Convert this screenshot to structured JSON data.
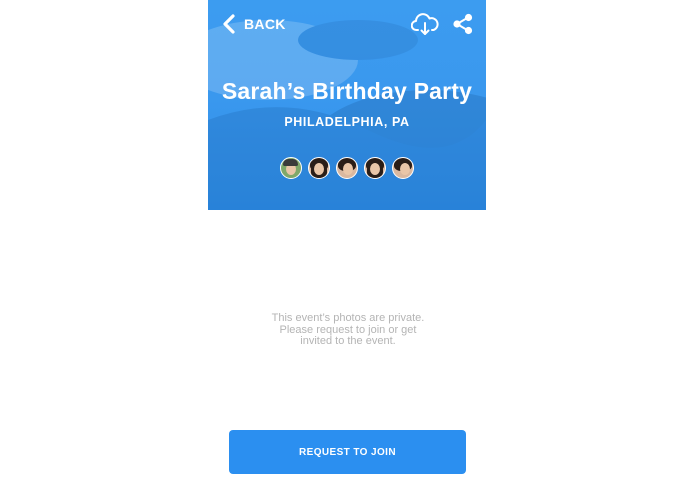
{
  "header": {
    "back_label": "BACK",
    "icons": [
      "chevron-left-icon",
      "cloud-download-icon",
      "share-icon"
    ]
  },
  "event": {
    "title": "Sarah’s Birthday Party",
    "location": "PHILADELPHIA, PA",
    "attendee_avatars": 5
  },
  "privacy": {
    "lines": [
      "This event’s photos are private.",
      "Please request to join or get",
      "invited to the event."
    ]
  },
  "actions": {
    "request_join_label": "REQUEST TO JOIN"
  },
  "colors": {
    "hero_blue": "#3a98ee",
    "button_blue": "#2b8ff0",
    "muted_text": "#b4b4b4"
  }
}
